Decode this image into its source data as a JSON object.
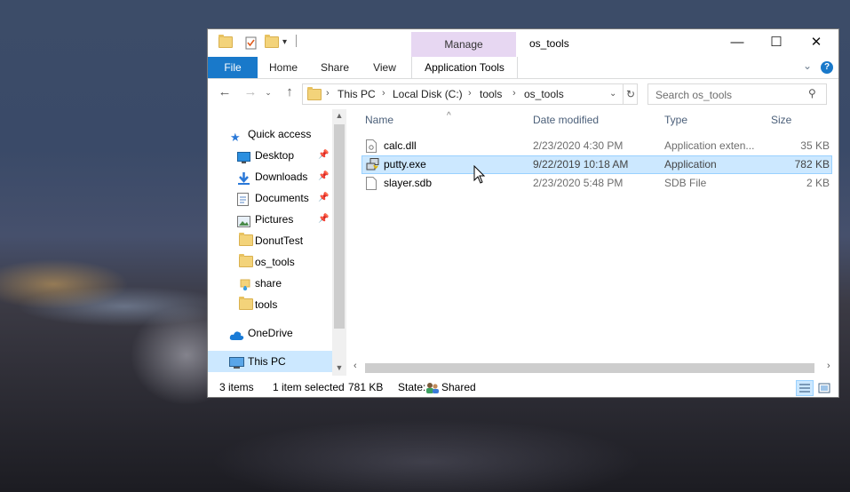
{
  "window": {
    "title": "os_tools",
    "contextual_tab_group": "Manage"
  },
  "ribbon": {
    "tabs": [
      "File",
      "Home",
      "Share",
      "View",
      "Application Tools"
    ]
  },
  "address": {
    "crumbs": [
      "This PC",
      "Local Disk (C:)",
      "tools",
      "os_tools"
    ]
  },
  "search": {
    "placeholder": "Search os_tools"
  },
  "navpane": {
    "items": [
      {
        "label": "Quick access",
        "icon": "star-icon",
        "pinned": false
      },
      {
        "label": "Desktop",
        "icon": "desktop-icon",
        "pinned": true
      },
      {
        "label": "Downloads",
        "icon": "download-icon",
        "pinned": true
      },
      {
        "label": "Documents",
        "icon": "documents-icon",
        "pinned": true
      },
      {
        "label": "Pictures",
        "icon": "pictures-icon",
        "pinned": true
      },
      {
        "label": "DonutTest",
        "icon": "folder-icon",
        "pinned": false
      },
      {
        "label": "os_tools",
        "icon": "folder-icon",
        "pinned": false
      },
      {
        "label": "share",
        "icon": "shared-folder-icon",
        "pinned": false
      },
      {
        "label": "tools",
        "icon": "folder-icon",
        "pinned": false
      },
      {
        "label": "OneDrive",
        "icon": "cloud-icon",
        "pinned": false
      },
      {
        "label": "This PC",
        "icon": "computer-icon",
        "pinned": false,
        "selected": true
      }
    ]
  },
  "filelist": {
    "columns": {
      "name": "Name",
      "date": "Date modified",
      "type": "Type",
      "size": "Size"
    },
    "rows": [
      {
        "name": "calc.dll",
        "date": "2/23/2020 4:30 PM",
        "type": "Application exten...",
        "size": "35 KB",
        "icon": "dll-file-icon",
        "selected": false
      },
      {
        "name": "putty.exe",
        "date": "9/22/2019 10:18 AM",
        "type": "Application",
        "size": "782 KB",
        "icon": "putty-icon",
        "selected": true
      },
      {
        "name": "slayer.sdb",
        "date": "2/23/2020 5:48 PM",
        "type": "SDB File",
        "size": "2 KB",
        "icon": "file-icon",
        "selected": false
      }
    ]
  },
  "status": {
    "item_count": "3 items",
    "selection": "1 item selected",
    "selection_size": "781 KB",
    "state_label": "State:",
    "state_value": "Shared"
  },
  "colors": {
    "accent": "#1979ca",
    "selection": "#cce8ff",
    "manage_tab": "#e7d7f2"
  }
}
